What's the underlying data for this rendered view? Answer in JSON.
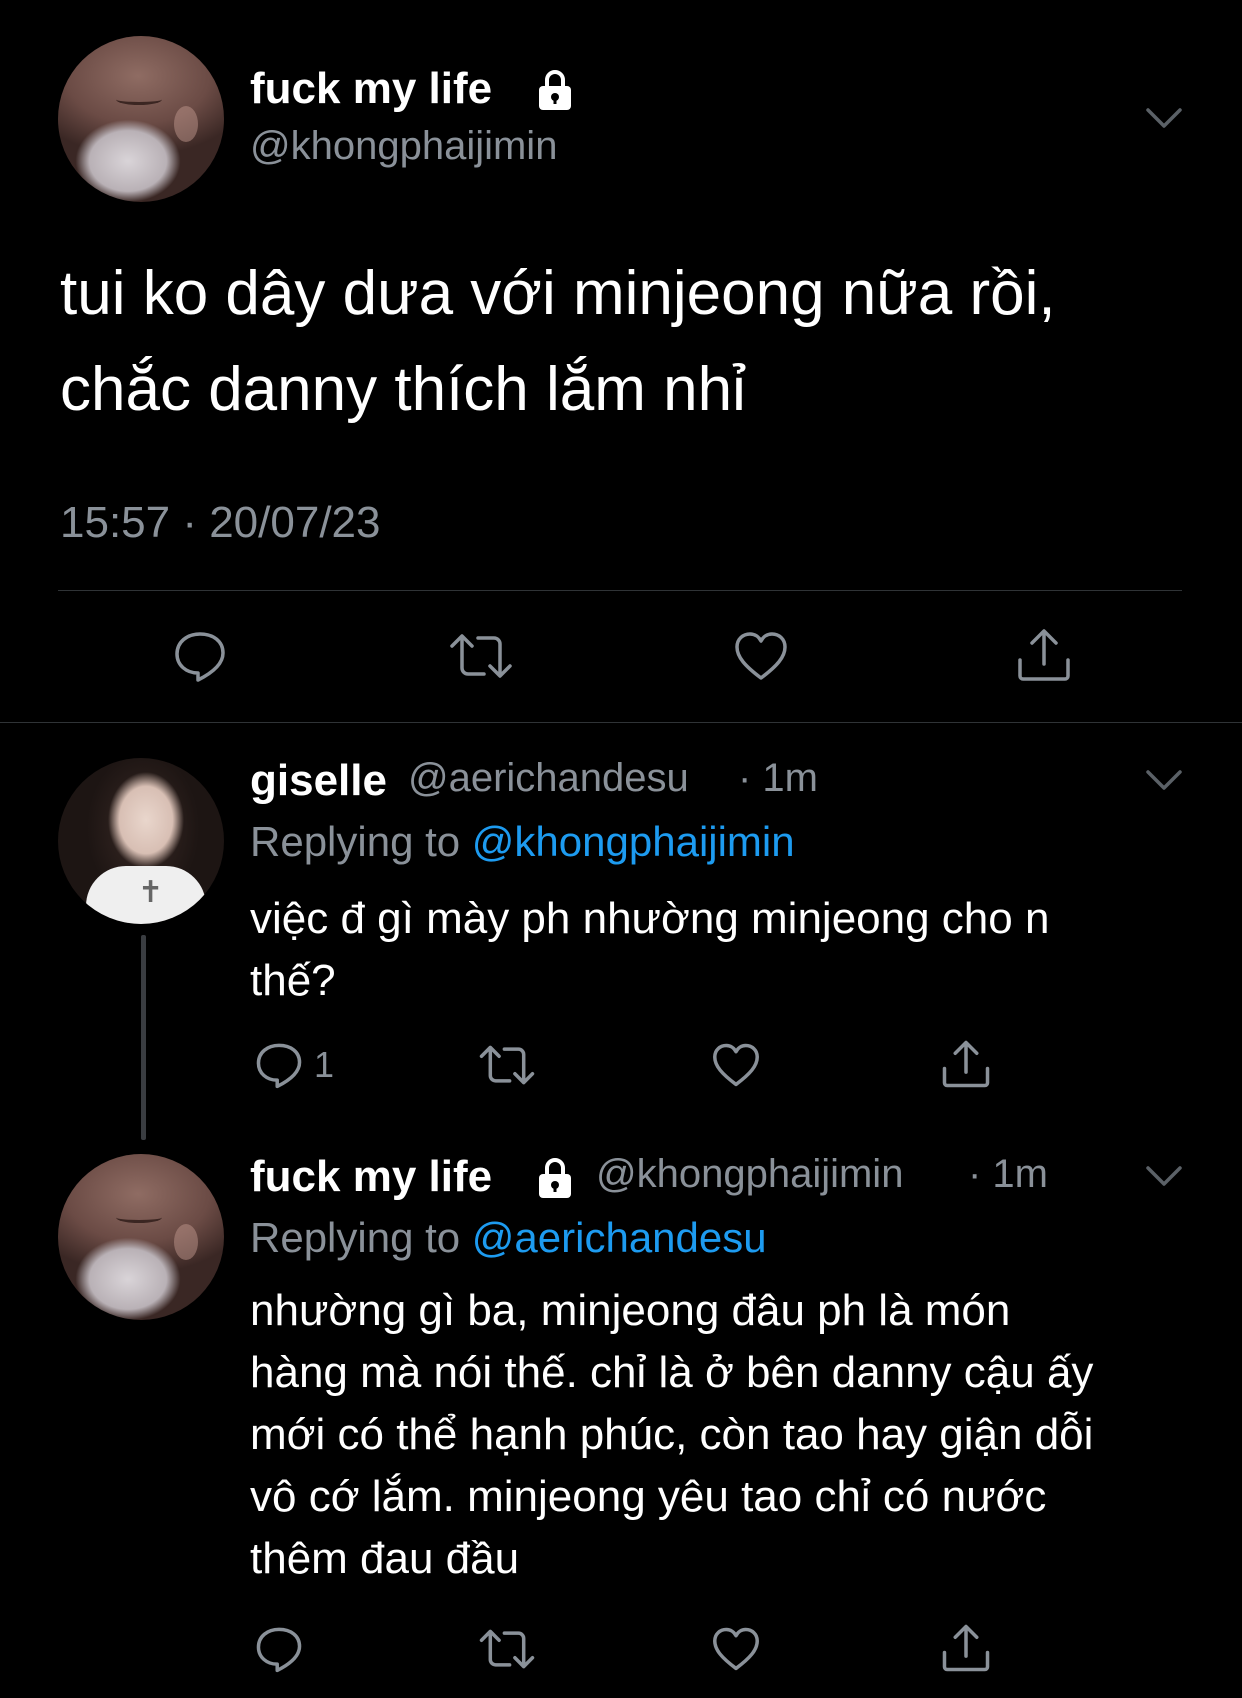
{
  "main_tweet": {
    "author_name": "fuck my life",
    "author_handle": "@khongphaijimin",
    "text_line1": "tui ko dây dưa với minjeong nữa rồi,",
    "text_line2": "chắc danny thích lắm nhỉ",
    "timestamp": "15:57 · 20/07/23"
  },
  "replies": [
    {
      "author_name": "giselle",
      "author_handle": "@aerichandesu",
      "time": "· 1m",
      "replying_prefix": "Replying to",
      "replying_to": "@khongphaijimin",
      "text_lines": [
        "việc đ gì mày ph nhường minjeong cho n",
        "thế?"
      ],
      "reply_count": "1"
    },
    {
      "author_name": "fuck my life",
      "author_handle": "@khongphaijimin",
      "time": "· 1m",
      "replying_prefix": "Replying to",
      "replying_to": "@aerichandesu",
      "text_lines": [
        "nhường gì ba, minjeong đâu ph là món",
        "hàng mà nói thế. chỉ là ở bên danny cậu ấy",
        "mới có thể hạnh phúc, còn tao hay giận dỗi",
        "vô cớ lắm. minjeong yêu tao chỉ có nước",
        "thêm đau đầu"
      ]
    }
  ],
  "colors": {
    "background": "#000000",
    "text": "#ffffff",
    "muted": "#8a9199",
    "accent": "#1d9bf0"
  },
  "icons": [
    "lock-icon",
    "chevron-down-icon",
    "reply-icon",
    "retweet-icon",
    "like-icon",
    "share-icon"
  ]
}
